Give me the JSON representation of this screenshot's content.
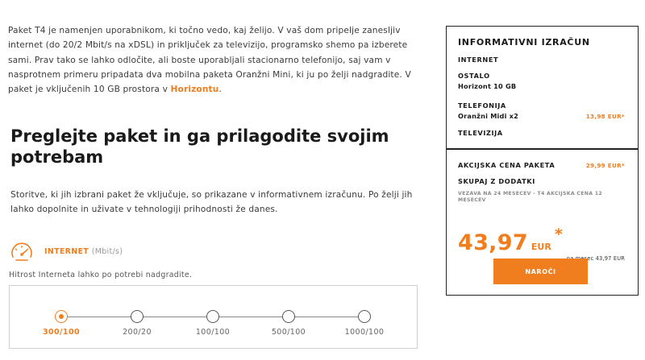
{
  "intro": {
    "text_before_link": "Paket T4 je namenjen uporabnikom, ki točno vedo, kaj želijo. V vaš dom pripelje zanesljiv internet (do 20/2 Mbit/s na xDSL) in priključek za televizijo, programsko shemo pa izberete sami. Prav tako se lahko odločite, ali boste uporabljali stacionarno telefonijo, saj vam v nasprotnem primeru pripadata dva mobilna paketa Oranžni Mini, ki ju po želji nadgradite. V paket je vključenih 10 GB prostora v ",
    "link_text": "Horizontu",
    "text_after_link": "."
  },
  "heading": "Preglejte paket in ga prilagodite svojim potrebam",
  "description": "Storitve, ki jih izbrani paket že vključuje, so prikazane v informativnem izračunu. Po želji jih lahko dopolnite in uživate v tehnologiji prihodnosti že danes.",
  "internet_section": {
    "icon": "speedometer-icon",
    "title": "INTERNET",
    "unit": "(Mbit/s)",
    "hint": "Hitrost Interneta lahko po potrebi nadgradite.",
    "selected_index": 0,
    "options": [
      {
        "label": "300/100",
        "selected": true
      },
      {
        "label": "200/20",
        "selected": false
      },
      {
        "label": "100/100",
        "selected": false
      },
      {
        "label": "500/100",
        "selected": false
      },
      {
        "label": "1000/100",
        "selected": false
      }
    ]
  },
  "calculator": {
    "title": "INFORMATIVNI IZRAČUN",
    "internet_label": "INTERNET",
    "other_label": "OSTALO",
    "other_item": "Horizont 10 GB",
    "telephony_label": "TELEFONIJA",
    "telephony_item": "Oranžni Midi x2",
    "telephony_price": "13,98 EUR*",
    "tv_label": "TELEVIZIJA",
    "promo_label": "AKCIJSKA CENA PAKETA",
    "promo_price": "29,99 EUR*",
    "total_label": "SKUPAJ Z DODATKI",
    "binding_note": "VEZAVA NA 24 MESECEV - T4 AKCIJSKA CENA 12 MESECEV",
    "total_price": "43,97",
    "total_currency": "EUR",
    "total_star": "*",
    "monthly_note": "na mesec 43,97 EUR"
  },
  "order_button": "NAROČI",
  "colors": {
    "accent": "#f07d1e",
    "text": "#3a3a3a",
    "border": "#222222"
  }
}
